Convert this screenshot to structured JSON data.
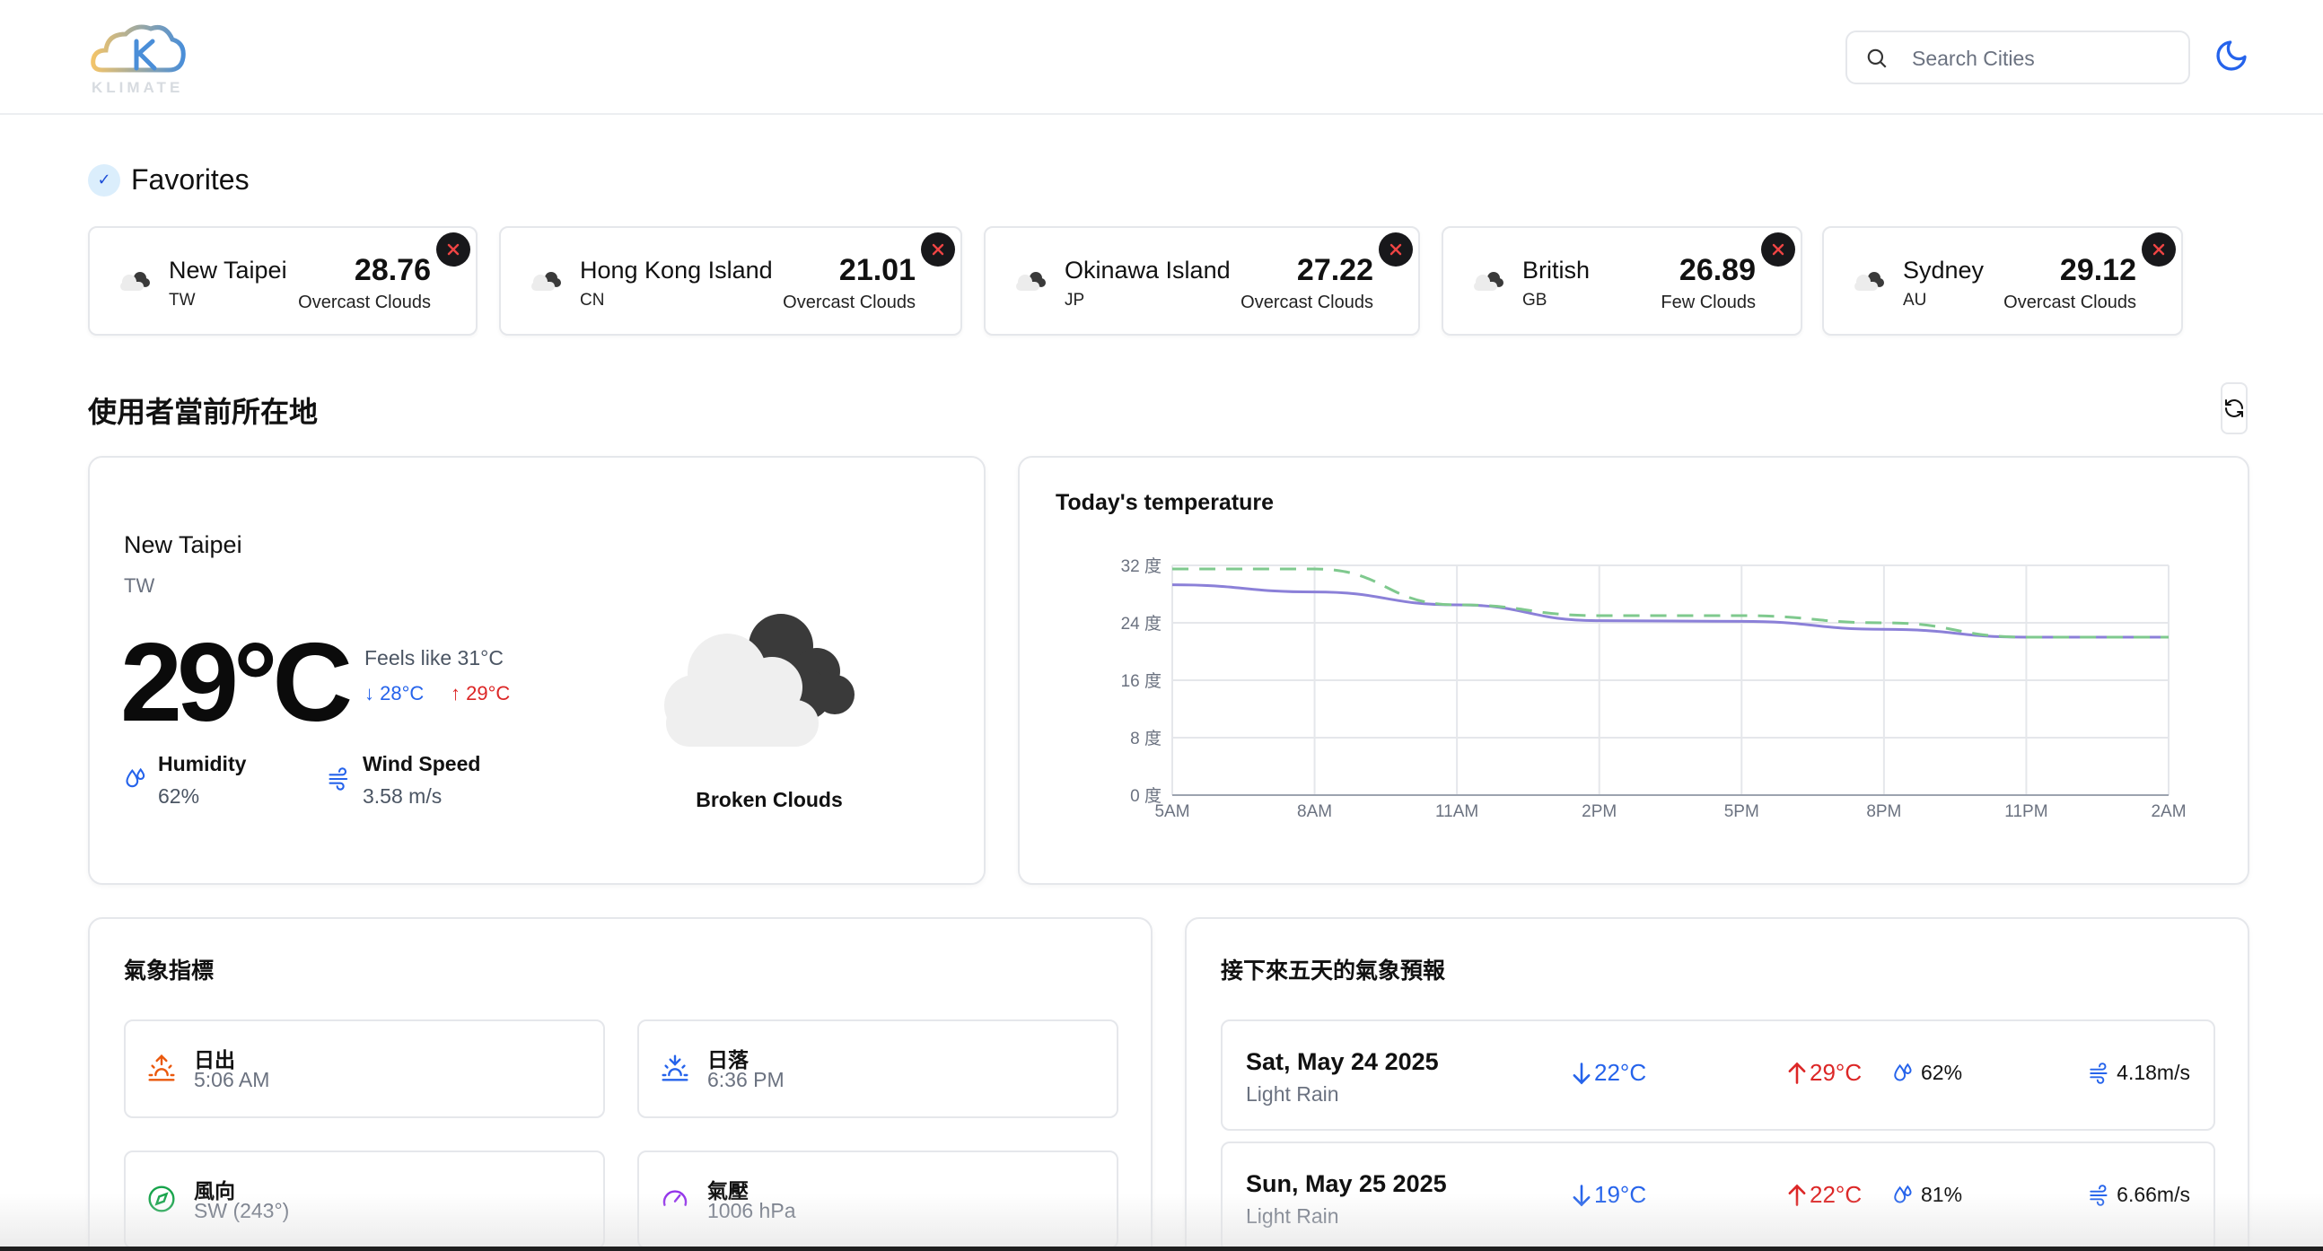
{
  "header": {
    "logo_text": "KLIMATE",
    "search_placeholder": "Search Cities"
  },
  "favorites": {
    "title": "Favorites",
    "items": [
      {
        "name": "New Taipei",
        "country": "TW",
        "temp": "28.76",
        "desc": "Overcast Clouds"
      },
      {
        "name": "Hong Kong Island",
        "country": "CN",
        "temp": "21.01",
        "desc": "Overcast Clouds"
      },
      {
        "name": "Okinawa Island",
        "country": "JP",
        "temp": "27.22",
        "desc": "Overcast Clouds"
      },
      {
        "name": "British",
        "country": "GB",
        "temp": "26.89",
        "desc": "Few Clouds"
      },
      {
        "name": "Sydney",
        "country": "AU",
        "temp": "29.12",
        "desc": "Overcast Clouds"
      }
    ]
  },
  "location": {
    "title": "使用者當前所在地",
    "city": "New Taipei",
    "country": "TW",
    "temp": "29°C",
    "feels_like": "Feels like 31°C",
    "min": "28°C",
    "max": "29°C",
    "humidity_label": "Humidity",
    "humidity_value": "62%",
    "wind_label": "Wind Speed",
    "wind_value": "3.58 m/s",
    "condition": "Broken Clouds"
  },
  "chart_data": {
    "type": "line",
    "title": "Today's temperature",
    "categories": [
      "5AM",
      "8AM",
      "11AM",
      "2PM",
      "5PM",
      "8PM",
      "11PM",
      "2AM"
    ],
    "y_ticks": [
      "0 度",
      "8 度",
      "16 度",
      "24 度",
      "32 度"
    ],
    "ylim": [
      0,
      32
    ],
    "grid": true,
    "series": [
      {
        "key": "temp",
        "color": "#8b80d8",
        "dashed": false,
        "values": [
          29.3,
          28.3,
          26.5,
          24.3,
          24.2,
          23.1,
          22.0,
          22.0
        ]
      },
      {
        "key": "feels_like",
        "color": "#7fc98e",
        "dashed": true,
        "values": [
          31.5,
          31.5,
          26.5,
          25.0,
          25.0,
          24.0,
          22.0,
          22.0
        ]
      }
    ]
  },
  "metrics": {
    "title": "氣象指標",
    "items": [
      {
        "label": "日出",
        "value": "5:06 AM",
        "icon": "sunrise-icon"
      },
      {
        "label": "日落",
        "value": "6:36 PM",
        "icon": "sunset-icon"
      },
      {
        "label": "風向",
        "value": "SW (243°)",
        "icon": "compass-icon"
      },
      {
        "label": "氣壓",
        "value": "1006 hPa",
        "icon": "gauge-icon"
      }
    ]
  },
  "forecast": {
    "title": "接下來五天的氣象預報",
    "days": [
      {
        "date": "Sat, May 24 2025",
        "cond": "Light Rain",
        "min": "22°C",
        "max": "29°C",
        "humidity": "62%",
        "wind": "4.18m/s"
      },
      {
        "date": "Sun, May 25 2025",
        "cond": "Light Rain",
        "min": "19°C",
        "max": "22°C",
        "humidity": "81%",
        "wind": "6.66m/s"
      }
    ]
  },
  "colors": {
    "accent": "#2563eb",
    "min_temp": "#2563eb",
    "max_temp": "#dc2626",
    "remove_button": "#18181b",
    "remove_x": "#ef4444"
  }
}
